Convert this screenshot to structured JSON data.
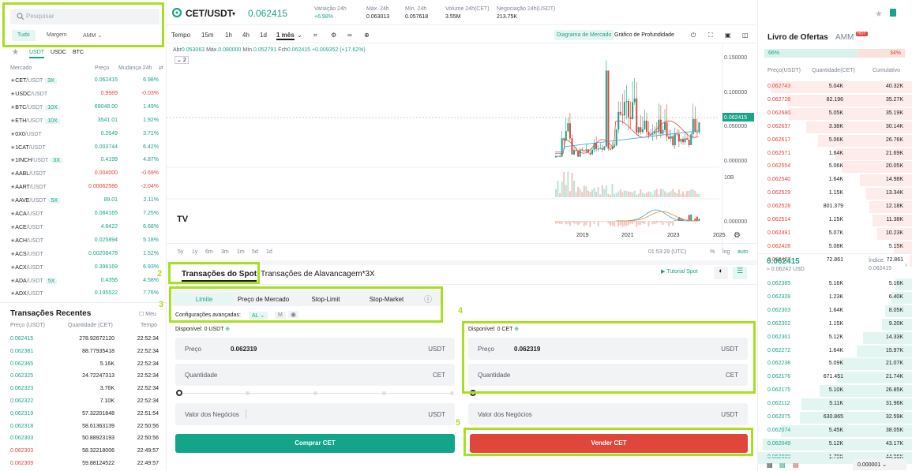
{
  "left": {
    "search_placeholder": "Pesquisar",
    "filters": [
      "Tudo",
      "Margem",
      "AMM"
    ],
    "quote_tabs": [
      "USDT",
      "USDC",
      "BTC"
    ],
    "headers": {
      "market": "Mercado",
      "price": "Preço",
      "change": "Mudança 24h"
    },
    "markets": [
      {
        "base": "CET",
        "quote": "/USDT",
        "lev": "3X",
        "price": "0.062415",
        "change": "6.98%",
        "up": true
      },
      {
        "base": "USDC",
        "quote": "/USDT",
        "lev": "",
        "price": "0.9989",
        "change": "-0.03%",
        "up": false
      },
      {
        "base": "BTC",
        "quote": "/USDT",
        "lev": "10X",
        "price": "68048.00",
        "change": "1.49%",
        "up": true
      },
      {
        "base": "ETH",
        "quote": "/USDT",
        "lev": "10X",
        "price": "3541.01",
        "change": "1.92%",
        "up": true
      },
      {
        "base": "0X0",
        "quote": "/USDT",
        "lev": "",
        "price": "0.2649",
        "change": "3.71%",
        "up": true
      },
      {
        "base": "1CAT",
        "quote": "/USDT",
        "lev": "",
        "price": "0.003744",
        "change": "6.42%",
        "up": true
      },
      {
        "base": "1INCH",
        "quote": "/USDT",
        "lev": "3X",
        "price": "0.4199",
        "change": "4.87%",
        "up": true
      },
      {
        "base": "AABL",
        "quote": "/USDT",
        "lev": "",
        "price": "0.004000",
        "change": "-0.69%",
        "up": false
      },
      {
        "base": "AART",
        "quote": "/USDT",
        "lev": "",
        "price": "0.00062586",
        "change": "-2.04%",
        "up": false
      },
      {
        "base": "AAVE",
        "quote": "/USDT",
        "lev": "5X",
        "price": "89.01",
        "change": "2.11%",
        "up": true
      },
      {
        "base": "ACA",
        "quote": "/USDT",
        "lev": "",
        "price": "0.084165",
        "change": "7.25%",
        "up": true
      },
      {
        "base": "ACE",
        "quote": "/USDT",
        "lev": "",
        "price": "4.6422",
        "change": "6.68%",
        "up": true
      },
      {
        "base": "ACH",
        "quote": "/USDT",
        "lev": "",
        "price": "0.025894",
        "change": "5.18%",
        "up": true
      },
      {
        "base": "ACS",
        "quote": "/USDT",
        "lev": "",
        "price": "0.00208478",
        "change": "1.52%",
        "up": true
      },
      {
        "base": "ACX",
        "quote": "/USDT",
        "lev": "",
        "price": "0.396169",
        "change": "6.93%",
        "up": true
      },
      {
        "base": "ADA",
        "quote": "/USDT",
        "lev": "5X",
        "price": "0.4356",
        "change": "4.58%",
        "up": true
      },
      {
        "base": "ADX",
        "quote": "/USDT",
        "lev": "",
        "price": "0.195522",
        "change": "7.76%",
        "up": true
      }
    ],
    "recent_title": "Transações Recentes",
    "mine_label": "Meu",
    "recent_headers": {
      "price": "Preço (USDT)",
      "qty": "Quantidade (CET)",
      "time": "Tempo"
    },
    "trades": [
      {
        "price": "0.062415",
        "qty": "278.92672120",
        "time": "22:52:34",
        "up": true
      },
      {
        "price": "0.062381",
        "qty": "88.77935418",
        "time": "22:52:34",
        "up": true
      },
      {
        "price": "0.062365",
        "qty": "5.16K",
        "time": "22:52:34",
        "up": true
      },
      {
        "price": "0.062325",
        "qty": "24.72247313",
        "time": "22:52:34",
        "up": true
      },
      {
        "price": "0.062323",
        "qty": "3.76K",
        "time": "22:52:34",
        "up": true
      },
      {
        "price": "0.062322",
        "qty": "7.10K",
        "time": "22:52:34",
        "up": true
      },
      {
        "price": "0.062319",
        "qty": "57.32201848",
        "time": "22:51:54",
        "up": true
      },
      {
        "price": "0.062318",
        "qty": "58.61363139",
        "time": "22:50:56",
        "up": true
      },
      {
        "price": "0.062303",
        "qty": "50.88923193",
        "time": "22:50:56",
        "up": true
      },
      {
        "price": "0.062303",
        "qty": "58.32218006",
        "time": "22:49:57",
        "up": false
      },
      {
        "price": "0.062309",
        "qty": "59.88124522",
        "time": "22:49:57",
        "up": false
      }
    ]
  },
  "header": {
    "pair": "CET/USDT",
    "last": "0.062415",
    "stats": [
      {
        "label": "Variação 24h",
        "value": "+6.98%",
        "green": true
      },
      {
        "label": "Máx. 24h",
        "value": "0.063013",
        "green": false
      },
      {
        "label": "Mín. 24h",
        "value": "0.057618",
        "green": false
      },
      {
        "label": "Volume 24h(CET)",
        "value": "3.55M",
        "green": false
      },
      {
        "label": "Negociação 24h(USDT)",
        "value": "213.75K",
        "green": false
      }
    ]
  },
  "chart": {
    "timeframes": [
      "Tempo",
      "15m",
      "1h",
      "4h",
      "1d",
      "1 mês"
    ],
    "view_tabs": [
      "Diagrama de Mercado",
      "Gráfico de Profundidade"
    ],
    "ohlc": {
      "open_label": "Abr",
      "open": "0.053063",
      "high_label": "Máx.",
      "high": "0.080000",
      "low_label": "Mín.",
      "low": "0.052791",
      "close_label": "Fch",
      "close": "0.062415",
      "chg": "+0.009352 (+17.62%)"
    },
    "indicator_count": "2",
    "price_axis": [
      "0.150000",
      "0.100000",
      "0.050000",
      "0.000000"
    ],
    "current_price_tag": "0.062415",
    "volume_axis_top": "10B",
    "macd_axis": "0.000000",
    "years": [
      "2019",
      "2021",
      "2023",
      "2025"
    ],
    "ranges": [
      "5y",
      "1y",
      "6m",
      "3m",
      "1m",
      "5d",
      "1d"
    ],
    "clock": "01:53:29 (UTC)",
    "scale_opts": [
      "%",
      "log",
      "auto"
    ],
    "chart_data": {
      "type": "candlestick",
      "x_axis_ticks": [
        "2019",
        "2021",
        "2023",
        "2025"
      ],
      "y_ticks": [
        "0.150000",
        "0.100000",
        "0.050000",
        "0.000000"
      ],
      "last_close": 0.062415
    }
  },
  "order": {
    "tabs": [
      "Transações do Spot",
      "Transações de Alavancagem*3X"
    ],
    "tutorial": "Tutorial Spot",
    "types": [
      "Limite",
      "Preço de Mercado",
      "Stop-Limit",
      "Stop-Market"
    ],
    "advanced": "Configurações avançadas:",
    "advanced_opts": [
      "AL",
      "M"
    ],
    "buy": {
      "available": "Disponível: 0 USDT",
      "price_label": "Preço",
      "price": "0.062319",
      "price_unit": "USDT",
      "qty_label": "Quantidade",
      "qty_unit": "CET",
      "total_label": "Valor dos Negócios",
      "total_unit": "USDT",
      "button": "Comprar CET"
    },
    "sell": {
      "available": "Disponível: 0 CET",
      "price_label": "Preço",
      "price": "0.062319",
      "price_unit": "USDT",
      "qty_label": "Quantidade",
      "qty_unit": "CET",
      "total_label": "Valor dos Negócios",
      "total_unit": "USDT",
      "button": "Vender CET"
    },
    "markers": [
      "2",
      "3",
      "4",
      "5"
    ]
  },
  "book": {
    "title": "Livro de Ofertas",
    "amm": "AMM",
    "hot": "HOT",
    "buy_pct": "66%",
    "sell_pct": "34%",
    "headers": {
      "price": "Preço(USDT)",
      "qty": "Quantidade(CET)",
      "cum": "Cumulativo"
    },
    "asks": [
      {
        "p": "0.062743",
        "q": "5.04K",
        "c": "40.32K",
        "d": 0.92
      },
      {
        "p": "0.062728",
        "q": "82.196",
        "c": "35.27K",
        "d": 0.81
      },
      {
        "p": "0.062680",
        "q": "5.05K",
        "c": "35.19K",
        "d": 0.8
      },
      {
        "p": "0.062637",
        "q": "3.38K",
        "c": "30.14K",
        "d": 0.69
      },
      {
        "p": "0.062617",
        "q": "5.06K",
        "c": "26.76K",
        "d": 0.61
      },
      {
        "p": "0.062571",
        "q": "1.64K",
        "c": "21.69K",
        "d": 0.5
      },
      {
        "p": "0.062554",
        "q": "5.06K",
        "c": "20.05K",
        "d": 0.46
      },
      {
        "p": "0.062540",
        "q": "1.64K",
        "c": "14.98K",
        "d": 0.34
      },
      {
        "p": "0.062529",
        "q": "1.15K",
        "c": "13.34K",
        "d": 0.3
      },
      {
        "p": "0.062528",
        "q": "801.379",
        "c": "12.18K",
        "d": 0.28
      },
      {
        "p": "0.062514",
        "q": "1.15K",
        "c": "11.38K",
        "d": 0.26
      },
      {
        "p": "0.062491",
        "q": "5.07K",
        "c": "10.23K",
        "d": 0.23
      },
      {
        "p": "0.062428",
        "q": "5.08K",
        "c": "5.15K",
        "d": 0.12
      },
      {
        "p": "0.062427",
        "q": "72.861",
        "c": "72.861",
        "d": 0.02
      }
    ],
    "mid_price": "0.062415",
    "mid_usd": "≈ 0.06242 USD",
    "index_label": "Índice:",
    "index_value": "0.062415",
    "bids": [
      {
        "p": "0.062365",
        "q": "5.16K",
        "c": "5.16K",
        "d": 0.11
      },
      {
        "p": "0.062328",
        "q": "1.23K",
        "c": "6.40K",
        "d": 0.14
      },
      {
        "p": "0.062303",
        "q": "1.64K",
        "c": "8.05K",
        "d": 0.18
      },
      {
        "p": "0.062302",
        "q": "1.15K",
        "c": "9.20K",
        "d": 0.2
      },
      {
        "p": "0.062301",
        "q": "5.12K",
        "c": "14.33K",
        "d": 0.32
      },
      {
        "p": "0.062272",
        "q": "1.64K",
        "c": "15.97K",
        "d": 0.36
      },
      {
        "p": "0.062238",
        "q": "5.09K",
        "c": "21.07K",
        "d": 0.47
      },
      {
        "p": "0.062176",
        "q": "671.451",
        "c": "21.74K",
        "d": 0.49
      },
      {
        "p": "0.062175",
        "q": "5.10K",
        "c": "26.85K",
        "d": 0.6
      },
      {
        "p": "0.062112",
        "q": "5.11K",
        "c": "31.96K",
        "d": 0.72
      },
      {
        "p": "0.062075",
        "q": "630.865",
        "c": "32.59K",
        "d": 0.73
      },
      {
        "p": "0.062074",
        "q": "5.45K",
        "c": "38.05K",
        "d": 0.85
      },
      {
        "p": "0.062049",
        "q": "5.12K",
        "c": "43.17K",
        "d": 0.97
      },
      {
        "p": "0.062009",
        "q": "1.79K",
        "c": "44.96K",
        "d": 1.0
      }
    ],
    "precision": "0.000001"
  }
}
